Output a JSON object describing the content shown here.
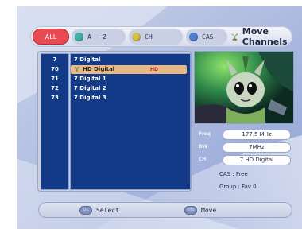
{
  "header": {
    "tabs": [
      {
        "id": "all",
        "label": "ALL",
        "active": true,
        "color": "#e84a54"
      },
      {
        "id": "az",
        "label": "A ~ Z",
        "dot_color": "#3fb4a8"
      },
      {
        "id": "ch",
        "label": "CH",
        "dot_color": "#d8c34a"
      },
      {
        "id": "cas",
        "label": "CAS",
        "dot_color": "#4f7fd8"
      }
    ],
    "title": "Move Channels",
    "title_icon": "move-channels-icon"
  },
  "channels": [
    {
      "number": "7",
      "name": "7 Digital",
      "selected": false
    },
    {
      "number": "70",
      "name": "HD Digital",
      "selected": true,
      "badge": "HD"
    },
    {
      "number": "71",
      "name": "7 Digital 1",
      "selected": false
    },
    {
      "number": "72",
      "name": "7 Digital 2",
      "selected": false
    },
    {
      "number": "73",
      "name": "7 Digital 3",
      "selected": false
    }
  ],
  "info": {
    "freq_label": "Freq",
    "freq": "177.5 MHz",
    "bw_label": "BW",
    "bw": "7MHz",
    "ch_label": "CH",
    "ch": "7 HD Digital",
    "cas": "CAS : Free",
    "group": "Group : Fav 0"
  },
  "footer": {
    "select_key": "OK",
    "select_label": "Select",
    "move_key": "Info",
    "move_label": "Move"
  },
  "colors": {
    "list_bg": "#123a86",
    "selected_row": "#e9b985",
    "accent_red": "#e84a54"
  }
}
